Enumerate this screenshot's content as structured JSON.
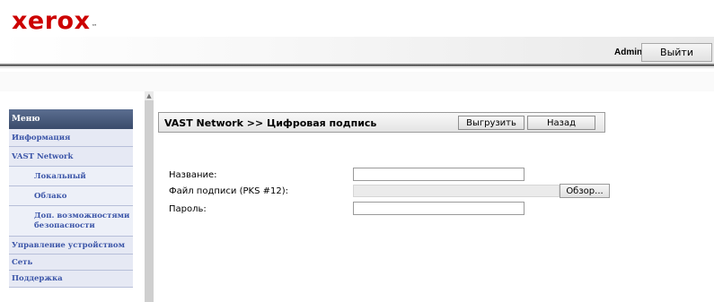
{
  "header": {
    "logo_text": "xerox",
    "logo_mark": "™",
    "user": "Admin",
    "logout_label": "Выйти"
  },
  "sidebar": {
    "title": "Меню",
    "items": [
      {
        "label": "Информация"
      },
      {
        "label": "VAST Network"
      },
      {
        "label": "Локальный"
      },
      {
        "label": "Облако"
      },
      {
        "label": "Доп. возможностями безопасности"
      },
      {
        "label": "Управление устройством"
      },
      {
        "label": "Сеть"
      },
      {
        "label": "Поддержка"
      }
    ]
  },
  "content": {
    "title": "VAST Network >> Цифровая подпись",
    "upload_label": "Выгрузить",
    "back_label": "Назад",
    "name_label": "Название:",
    "name_value": "",
    "file_label": "Файл подписи (PKS #12):",
    "browse_label": "Обзор...",
    "password_label": "Пароль:",
    "password_value": ""
  },
  "colors": {
    "brand": "#cc0000",
    "menu_header": "#3a4b6b",
    "menu_link": "#3b55a8"
  }
}
